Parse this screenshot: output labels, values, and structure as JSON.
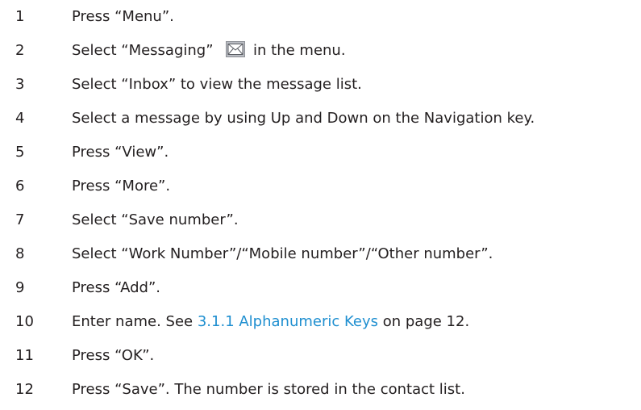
{
  "steps": [
    {
      "num": "1",
      "text": "Press “Menu”."
    },
    {
      "num": "2",
      "before": "Select “Messaging”",
      "icon": "envelope-icon",
      "after": "in the menu."
    },
    {
      "num": "3",
      "text": "Select “Inbox” to view the message list."
    },
    {
      "num": "4",
      "text": "Select a message by using Up and Down on the Navigation key."
    },
    {
      "num": "5",
      "text": "Press “View”."
    },
    {
      "num": "6",
      "text": "Press “More”."
    },
    {
      "num": "7",
      "text": "Select “Save number”."
    },
    {
      "num": "8",
      "text": "Select “Work Number”/“Mobile number”/“Other number”."
    },
    {
      "num": "9",
      "text": "Press “Add”."
    },
    {
      "num": "10",
      "before": "Enter name. See",
      "link": "3.1.1 Alphanumeric Keys",
      "after": "on page 12."
    },
    {
      "num": "11",
      "text": "Press “OK”."
    },
    {
      "num": "12",
      "text": "Press “Save”. The number is stored in the contact list."
    }
  ],
  "colors": {
    "text": "#231f20",
    "link": "#1f8fd0"
  }
}
